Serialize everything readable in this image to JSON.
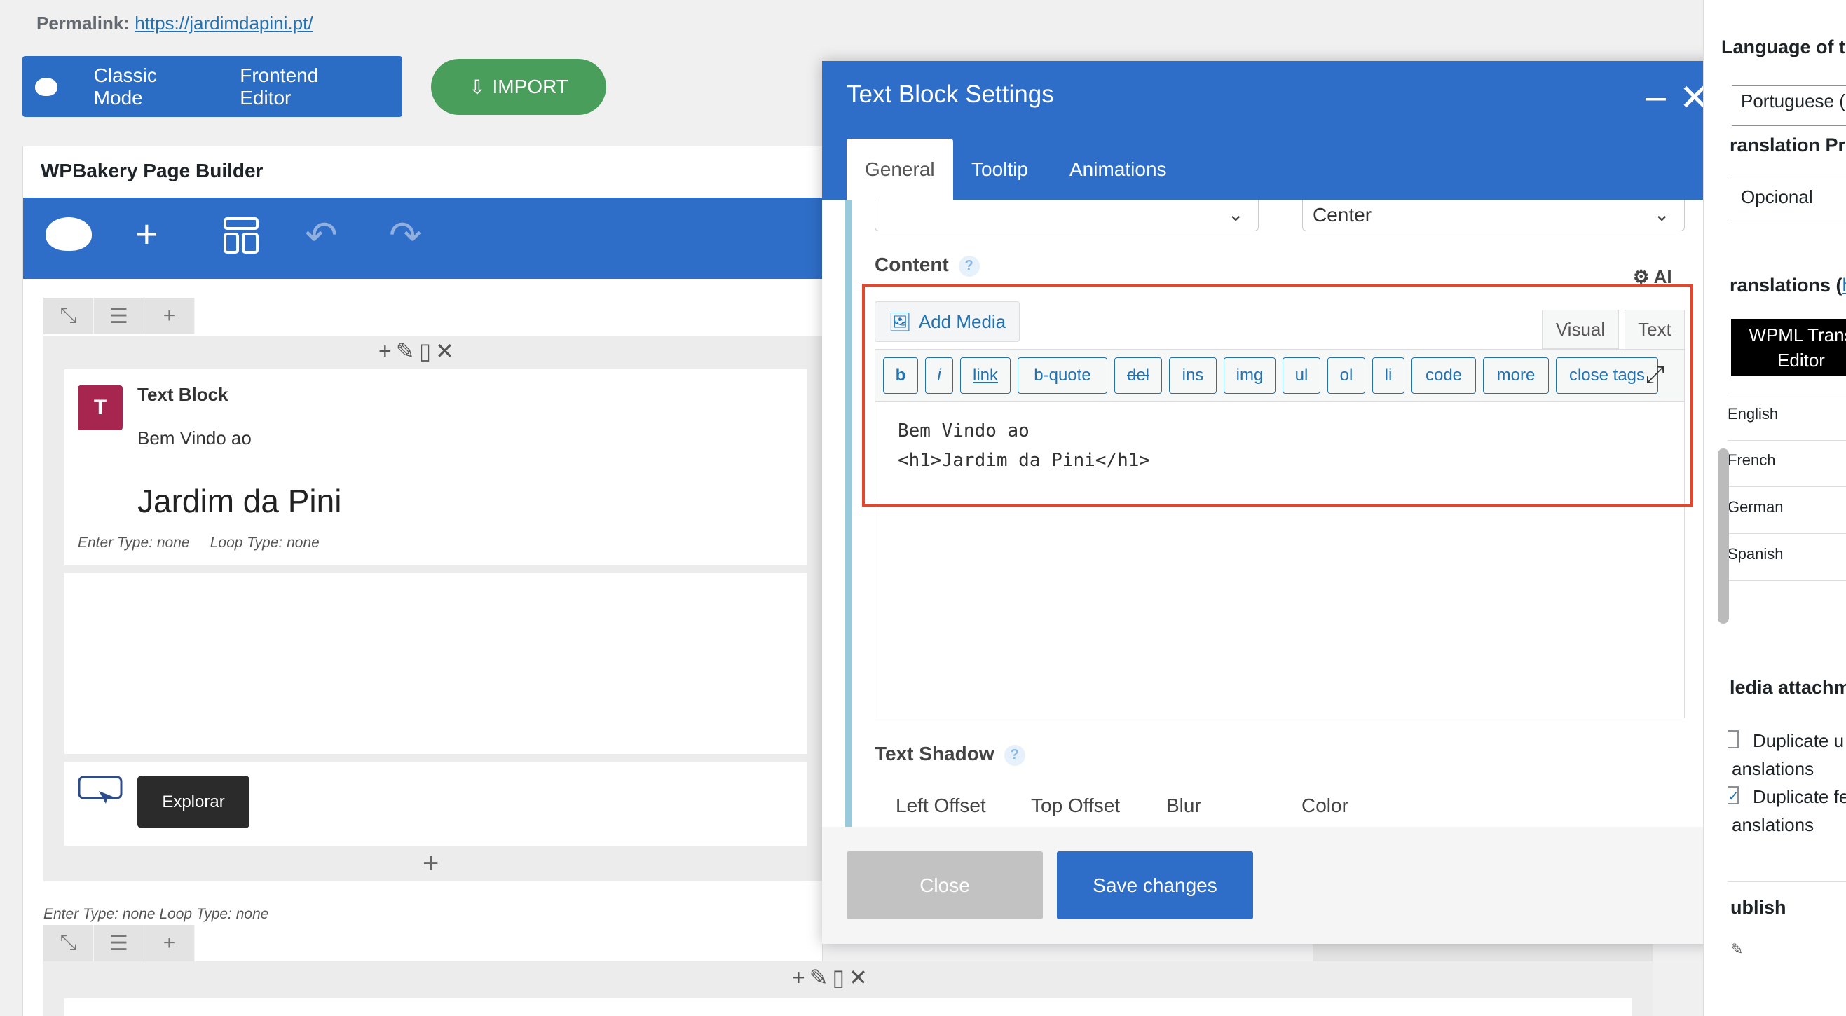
{
  "permalink": {
    "label": "Permalink:",
    "url": "https://jardimdapini.pt/"
  },
  "mode_bar": {
    "classic": "Classic Mode",
    "frontend": "Frontend Editor"
  },
  "import_label": "IMPORT",
  "builder": {
    "title": "WPBakery Page Builder"
  },
  "text_block": {
    "title": "Text Block",
    "line1": "Bem Vindo ao",
    "heading": "Jardim da Pini",
    "enter_type_label": "Enter Type",
    "enter_type_value": ": none",
    "loop_type_label": "Loop Type",
    "loop_type_value": ": none"
  },
  "button_element": {
    "label": "Explorar"
  },
  "row_meta": "Enter Type: none  Loop Type: none",
  "modal": {
    "title": "Text Block Settings",
    "tabs": [
      "General",
      "Tooltip",
      "Animations"
    ],
    "select_right": "Center",
    "content_label": "Content",
    "ai_label": "AI",
    "add_media": "Add Media",
    "editor_tabs": [
      "Visual",
      "Text"
    ],
    "quicktags": [
      "b",
      "i",
      "link",
      "b-quote",
      "del",
      "ins",
      "img",
      "ul",
      "ol",
      "li",
      "code",
      "more",
      "close tags"
    ],
    "editor_content": "Bem Vindo ao\n<h1>Jardim da Pini</h1>",
    "text_shadow_label": "Text Shadow",
    "shadow_fields": [
      "Left Offset",
      "Top Offset",
      "Blur",
      "Color"
    ],
    "close_label": "Close",
    "save_label": "Save changes"
  },
  "sidebar": {
    "language_label": "Language of th",
    "language_value": "Portuguese (",
    "translation_priority_label": "ranslation Pri",
    "translation_priority_value": "Opcional",
    "translations_label": "ranslations (",
    "translations_link": "h",
    "wpml_button": "WPML Trans Editor",
    "languages": [
      "English",
      "French",
      "German",
      "Spanish"
    ],
    "media_label": "ledia attachm",
    "dup1_a": "Duplicate u",
    "dup1_b": "anslations",
    "dup2_a": "Duplicate fe",
    "dup2_b": "anslations",
    "publish": "ublish"
  }
}
